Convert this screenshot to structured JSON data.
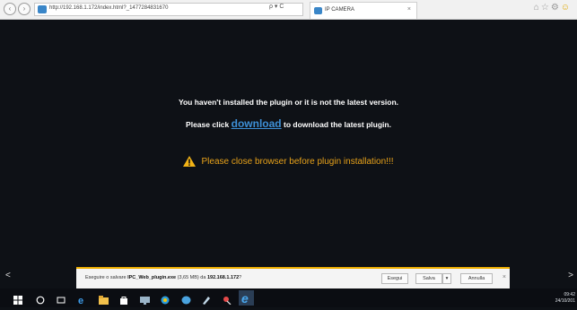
{
  "browser": {
    "url": "http://192.168.1.172/index.html?_1477284831670",
    "address_tools": "ρ ▾ C",
    "tab_title": "IP CAMERA",
    "tab_close": "×"
  },
  "content": {
    "message_line1": "You haven't installed the plugin or it is not the latest version.",
    "message_line2_prefix": "Please click ",
    "download_link": "download",
    "message_line2_suffix": " to download the latest plugin.",
    "warning_text": "Please close browser before plugin installation!!!"
  },
  "download_bar": {
    "prompt_prefix": "Eseguire o salvare ",
    "filename": "IPC_Web_plugin.exe",
    "prompt_middle": " (3,65 MB) da ",
    "host": "192.168.1.172",
    "prompt_suffix": "?",
    "run_label": "Esegui",
    "save_label": "Salva",
    "save_dropdown": "▾",
    "cancel_label": "Annulla",
    "close": "×"
  },
  "taskbar": {
    "time": "09:42",
    "date": "24/10/201"
  },
  "colors": {
    "background": "#0e1116",
    "link": "#3d8fd6",
    "warning": "#e8a21a",
    "notification_accent": "#f0b000"
  }
}
